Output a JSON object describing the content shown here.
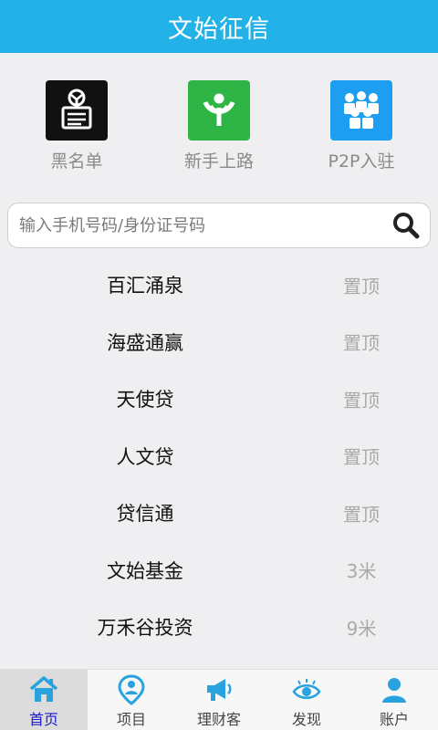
{
  "header": {
    "title": "文始征信"
  },
  "quick_links": [
    {
      "label": "黑名单",
      "icon": "blacklist-icon",
      "color": "#111111"
    },
    {
      "label": "新手上路",
      "icon": "wikimedia-icon",
      "color": "#2fb546"
    },
    {
      "label": "P2P入驻",
      "icon": "people-icon",
      "color": "#1e9ef0"
    }
  ],
  "search": {
    "placeholder": "输入手机号码/身份证号码",
    "value": ""
  },
  "list": [
    {
      "name": "百汇涌泉",
      "action": "置顶"
    },
    {
      "name": "海盛通赢",
      "action": "置顶"
    },
    {
      "name": "天使贷",
      "action": "置顶"
    },
    {
      "name": "人文贷",
      "action": "置顶"
    },
    {
      "name": "贷信通",
      "action": "置顶"
    },
    {
      "name": "文始基金",
      "action": "3米"
    },
    {
      "name": "万禾谷投资",
      "action": "9米"
    }
  ],
  "tabs": [
    {
      "label": "首页",
      "icon": "home-icon",
      "active": true
    },
    {
      "label": "项目",
      "icon": "location-pin-icon"
    },
    {
      "label": "理财客",
      "icon": "megaphone-icon"
    },
    {
      "label": "发现",
      "icon": "eye-icon"
    },
    {
      "label": "账户",
      "icon": "user-icon"
    }
  ],
  "colors": {
    "header": "#22b2e8",
    "tab_icon": "#29a3e0",
    "active_tab_label": "#1a1ad0"
  }
}
